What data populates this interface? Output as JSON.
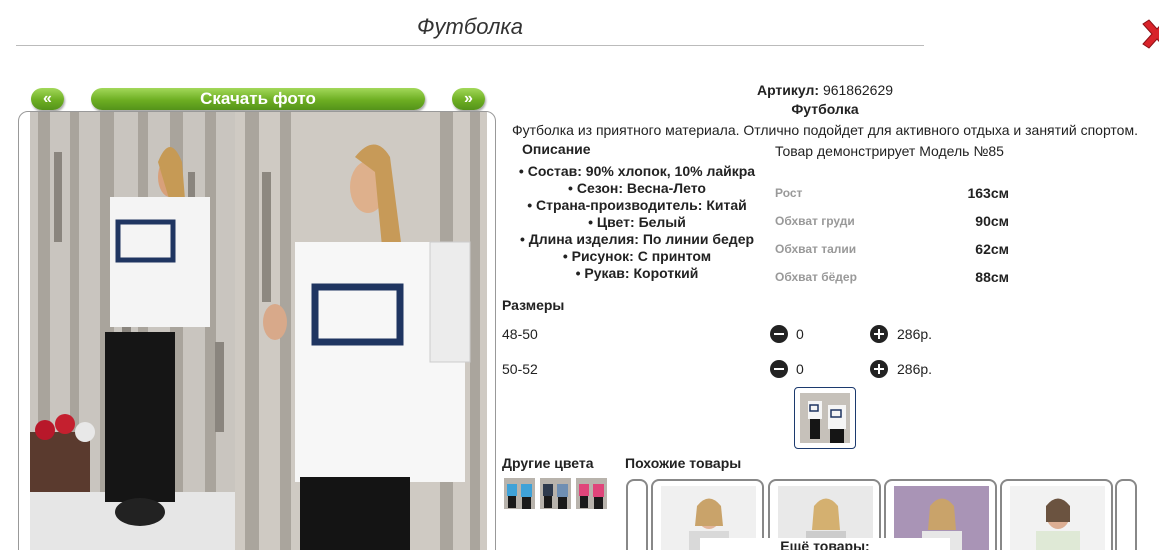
{
  "header": {
    "title": "Футболка"
  },
  "gallery": {
    "prev_label": "«",
    "next_label": "»",
    "download_label": "Скачать фото"
  },
  "product": {
    "article_label": "Артикул:",
    "article_value": "961862629",
    "name": "Футболка",
    "description": "Футболка из приятного материала. Отлично подойдет для активного отдыха и занятий спортом.",
    "description_heading": "Описание",
    "features": [
      "Состав: 90% хлопок, 10% лайкра",
      "Сезон: Весна-Лето",
      "Страна-производитель: Китай",
      "Цвет: Белый",
      "Длина изделия: По линии бедер",
      "Рисунок: С принтом",
      "Рукав: Короткий"
    ]
  },
  "model": {
    "note": "Товар демонстрирует Модель №85",
    "params": [
      {
        "label": "Рост",
        "value": "163см"
      },
      {
        "label": "Обхват груди",
        "value": "90см"
      },
      {
        "label": "Обхват талии",
        "value": "62см"
      },
      {
        "label": "Обхват бёдер",
        "value": "88см"
      }
    ]
  },
  "sizes": {
    "heading": "Размеры",
    "rows": [
      {
        "size": "48-50",
        "qty": "0",
        "price": "286р."
      },
      {
        "size": "50-52",
        "qty": "0",
        "price": "286р."
      }
    ]
  },
  "other_colors": {
    "heading": "Другие цвета",
    "colors": [
      "#3fa2d8",
      "#6f8fb3",
      "#e0457a"
    ]
  },
  "similar": {
    "heading": "Похожие товары",
    "more_label": "Ещё товары:"
  },
  "colors": {
    "accent": "#6dae22",
    "close": "#d8232a"
  }
}
